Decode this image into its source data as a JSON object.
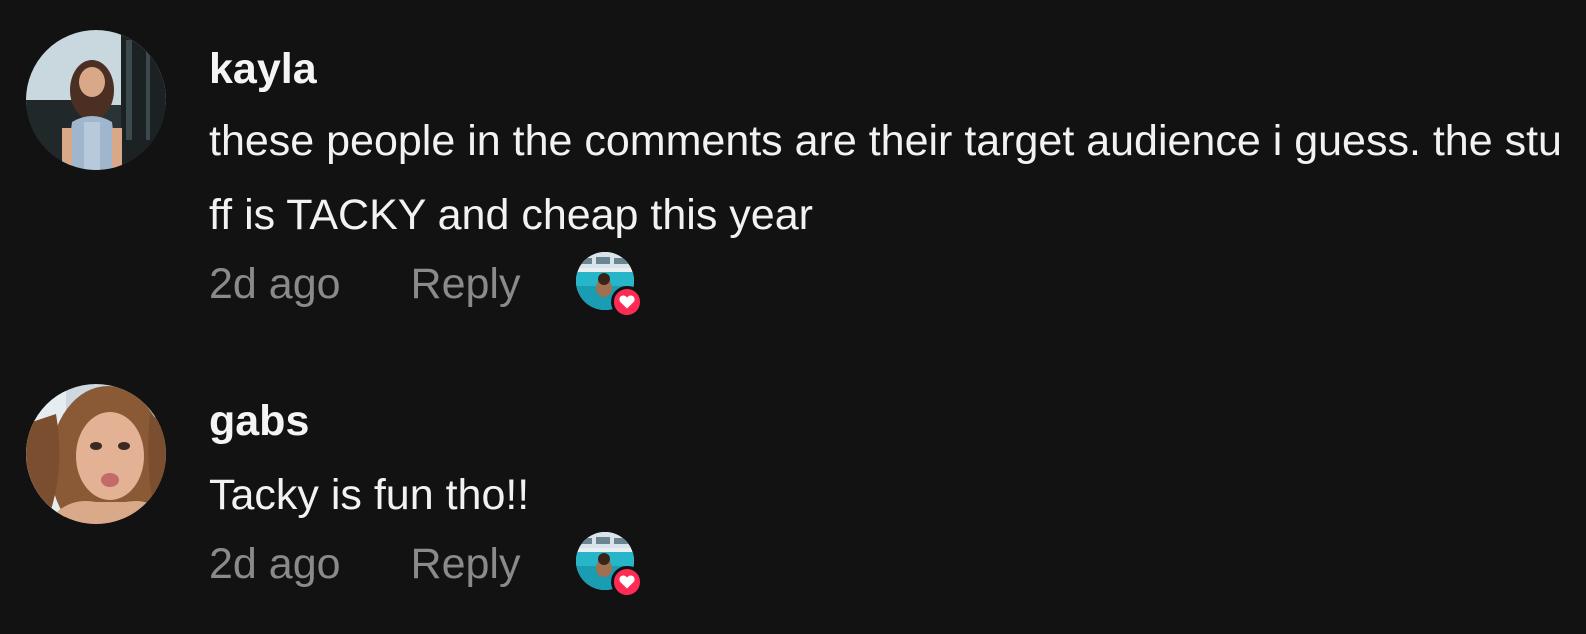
{
  "comments": [
    {
      "username": "kayla",
      "text": "these people in the comments are their target audience i guess. the stuff is TACKY and cheap this year",
      "timestamp": "2d ago",
      "reply_label": "Reply",
      "avatar_icon": "user-avatar-kayla",
      "creator_liked": true
    },
    {
      "username": "gabs",
      "text": "Tacky is fun tho!!",
      "timestamp": "2d ago",
      "reply_label": "Reply",
      "avatar_icon": "user-avatar-gabs",
      "creator_liked": true
    }
  ],
  "colors": {
    "background": "#121212",
    "username": "#f4f4f4",
    "text": "#f2f2f2",
    "meta": "#8a8a8a",
    "heart_badge": "#fe2c55"
  },
  "icons": {
    "creator_like": "creator-liked-heart-icon"
  }
}
